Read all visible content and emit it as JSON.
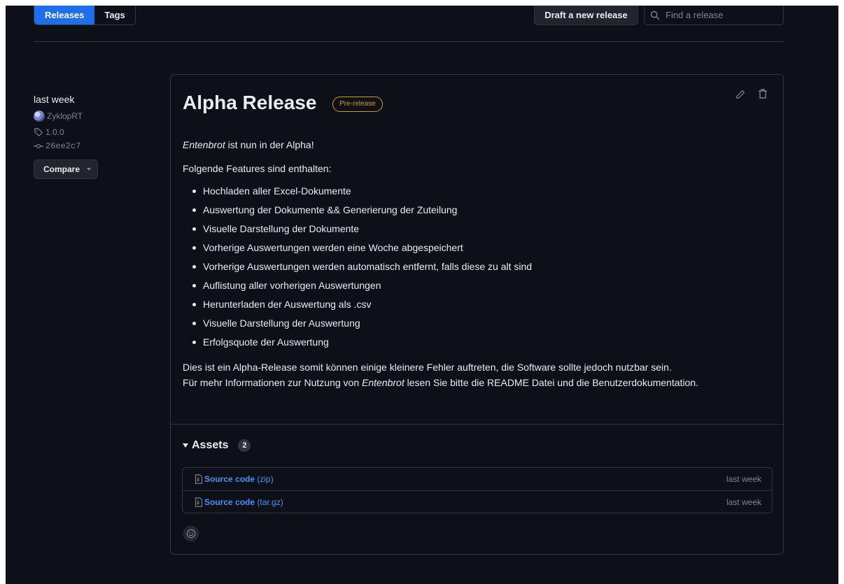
{
  "topbar": {
    "tabs": [
      {
        "label": "Releases",
        "active": true
      },
      {
        "label": "Tags",
        "active": false
      }
    ],
    "draft_button": "Draft a new release",
    "search_placeholder": "Find a release"
  },
  "meta": {
    "date": "last week",
    "author": "ZyklopRT",
    "tag": "1.0.0",
    "commit": "26ee2c7",
    "compare_label": "Compare"
  },
  "release": {
    "title": "Alpha Release",
    "badge": "Pre-release",
    "intro_em": "Entenbrot",
    "intro_rest": " ist nun in der Alpha!",
    "features_heading": "Folgende Features sind enthalten:",
    "features": [
      "Hochladen aller Excel-Dokumente",
      "Auswertung der Dokumente && Generierung der Zuteilung",
      "Visuelle Darstellung der Dokumente",
      "Vorherige Auswertungen werden eine Woche abgespeichert",
      "Vorherige Auswertungen werden automatisch entfernt, falls diese zu alt sind",
      "Auflistung aller vorherigen Auswertungen",
      "Herunterladen der Auswertung als .csv",
      "Visuelle Darstellung der Auswertung",
      "Erfolgsquote der Auswertung"
    ],
    "outro_line1": "Dies ist ein Alpha-Release somit können einige kleinere Fehler auftreten, die Software sollte jedoch nutzbar sein.",
    "outro_line2_a": "Für mehr Informationen zur Nutzung von ",
    "outro_line2_em": "Entenbrot",
    "outro_line2_b": " lesen Sie bitte die README Datei und die Benutzerdokumentation."
  },
  "assets": {
    "title": "Assets",
    "count": "2",
    "items": [
      {
        "name": "Source code",
        "format": " (zip)",
        "date": "last week"
      },
      {
        "name": "Source code",
        "format": " (tar.gz)",
        "date": "last week"
      }
    ]
  },
  "colors": {
    "background": "#0d1117",
    "accent": "#1f6feb",
    "link": "#4493f8",
    "prerelease": "#d29922",
    "border": "#30363d"
  }
}
